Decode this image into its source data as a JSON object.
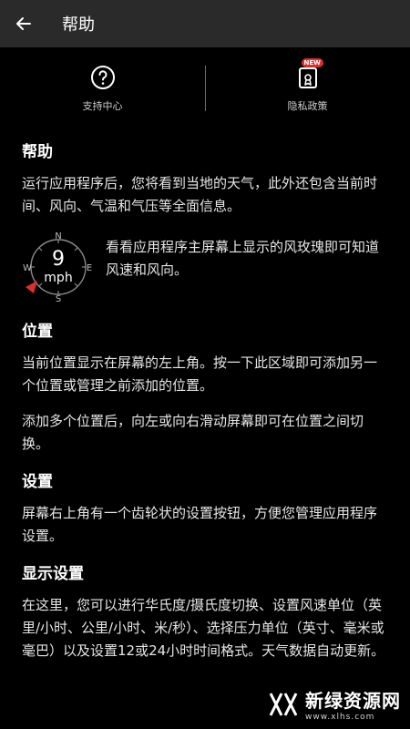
{
  "header": {
    "title": "帮助"
  },
  "quick": {
    "support_label": "支持中心",
    "privacy_label": "隐私政策",
    "new_badge": "NEW"
  },
  "sections": {
    "help": {
      "title": "帮助",
      "p1": "运行应用程序后，您将看到当地的天气，此外还包含当前时间、风向、气温和气压等全面信息。",
      "compass_text": "看看应用程序主屏幕上显示的风玫瑰即可知道风速和风向。",
      "compass": {
        "value": "9",
        "unit": "mph",
        "n": "N",
        "s": "S",
        "e": "E",
        "w": "W"
      }
    },
    "location": {
      "title": "位置",
      "p1": "当前位置显示在屏幕的左上角。按一下此区域即可添加另一个位置或管理之前添加的位置。",
      "p2": "添加多个位置后，向左或向右滑动屏幕即可在位置之间切换。"
    },
    "settings": {
      "title": "设置",
      "p1": "屏幕右上角有一个齿轮状的设置按钮，方便您管理应用程序设置。"
    },
    "display": {
      "title": "显示设置",
      "p1": "在这里，您可以进行华氏度/摄氏度切换、设置风速单位（英里/小时、公里/小时、米/秒）、选择压力单位（英寸、毫米或毫巴）以及设置12或24小时时间格式。天气数据自动更新。"
    }
  },
  "watermark": {
    "title": "新绿资源网",
    "url": "www.xlhs.com"
  },
  "colors": {
    "accent_red": "#d9302b",
    "topbar": "#2a2a2a"
  }
}
